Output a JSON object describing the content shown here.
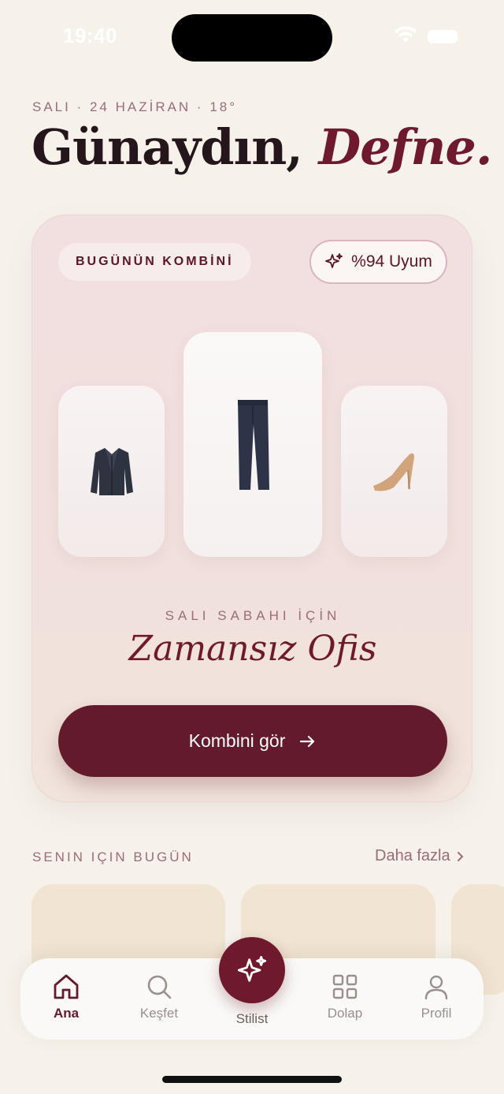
{
  "status": {
    "time": "19:40"
  },
  "header": {
    "date_line": "SALI · 24 HAZİRAN · 18°",
    "greeting_prefix": "Günaydın, ",
    "greeting_name": "Defne."
  },
  "hero": {
    "badge": "BUGÜNÜN KOMBİNİ",
    "match": "%94 Uyum",
    "items": [
      "jacket",
      "trousers",
      "heels"
    ],
    "occasion": "SALI SABAHI İÇİN",
    "outfit_name": "Zamansız Ofis",
    "cta_label": "Kombini gör"
  },
  "recommendations": {
    "title": "SENIN IÇIN BUGÜN",
    "more_label": "Daha fazla"
  },
  "tabs": {
    "home": "Ana",
    "explore": "Keşfet",
    "stylist": "Stilist",
    "closet": "Dolap",
    "profile": "Profil"
  },
  "colors": {
    "accent": "#631a2c",
    "background": "#f6f2ea",
    "muted": "#9b6c73"
  }
}
